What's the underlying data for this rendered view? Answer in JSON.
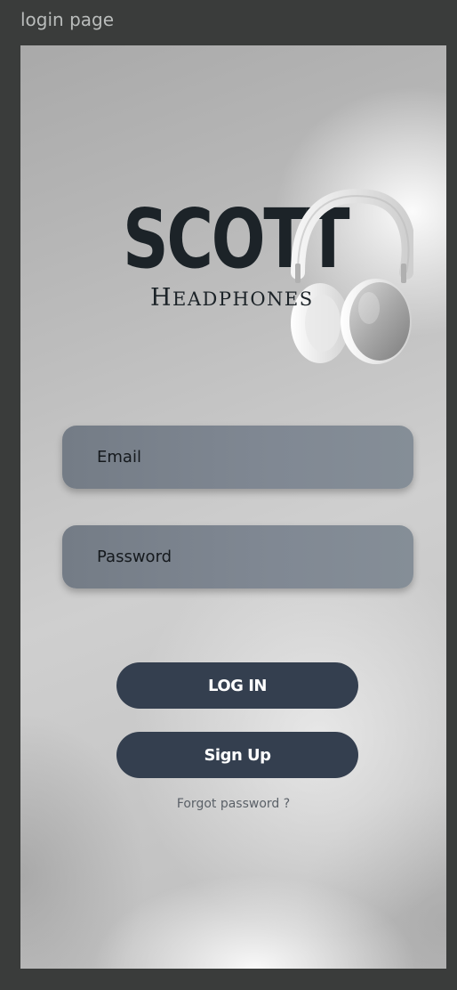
{
  "frame": {
    "label": "login page"
  },
  "logo": {
    "brand": "SCOTT",
    "subtitle": "Headphones"
  },
  "form": {
    "email_placeholder": "Email",
    "password_placeholder": "Password"
  },
  "actions": {
    "login_label": "LOG IN",
    "signup_label": "Sign Up",
    "forgot_label": "Forgot password ?"
  },
  "colors": {
    "background": "#3a3c3b",
    "field": "#7c848e",
    "button": "#343f4f",
    "brand_text": "#1c2328"
  },
  "icons": {
    "product_image": "headphones-icon"
  }
}
